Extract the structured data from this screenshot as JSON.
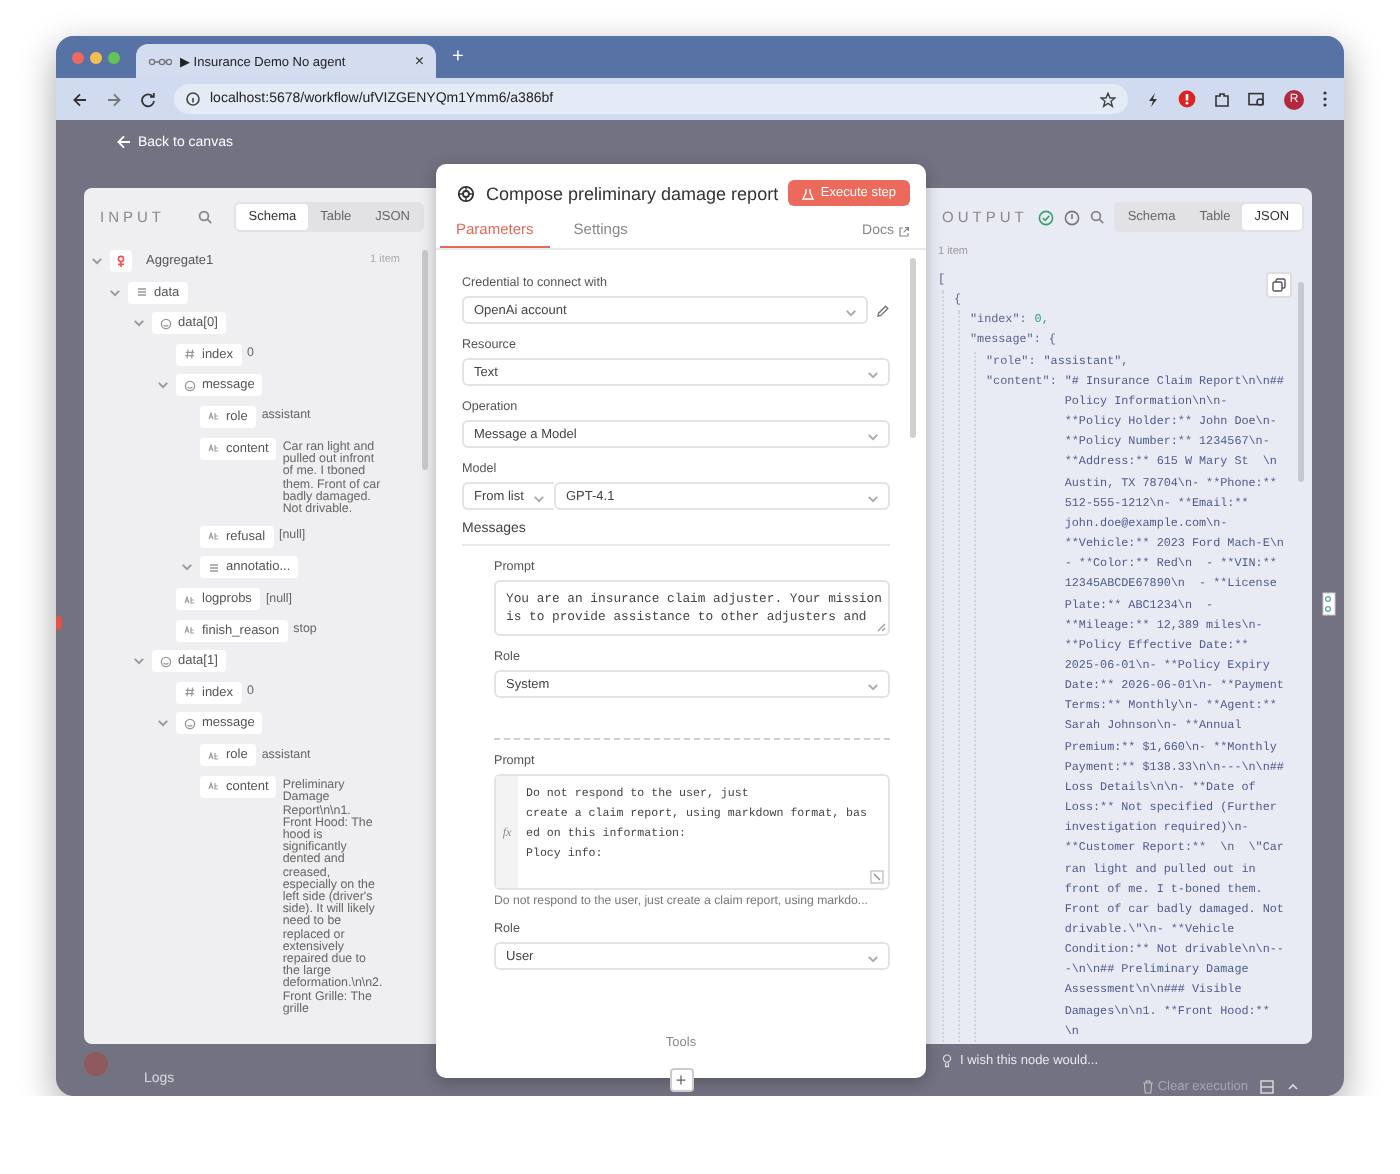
{
  "browser": {
    "tab": {
      "title": "▶ Insurance Demo No agent",
      "close": "×"
    },
    "new_tab": "+",
    "url": "localhost:5678/workflow/ufVIZGENYQm1Ymm6/a386bf",
    "profile": "R"
  },
  "back_link": "Back to canvas",
  "input_panel": {
    "title": "INPUT",
    "tabs": [
      {
        "label": "Schema",
        "selected": true
      },
      {
        "label": "Table",
        "selected": false
      },
      {
        "label": "JSON",
        "selected": false
      }
    ],
    "source": {
      "name": "Aggregate1",
      "count": "1 item",
      "expanded": true
    },
    "tree": [
      {
        "kind": "array",
        "name": "data",
        "expanded": true,
        "children": [
          {
            "kind": "object",
            "name": "data[0]",
            "expanded": true,
            "children": [
              {
                "kind": "number",
                "name": "index",
                "value": "0"
              },
              {
                "kind": "object",
                "name": "message",
                "expanded": true,
                "children": [
                  {
                    "kind": "string",
                    "name": "role",
                    "value": "assistant"
                  },
                  {
                    "kind": "string",
                    "name": "content",
                    "value": "Car ran light and pulled out infront of me. I tboned them. Front of car badly damaged. Not drivable."
                  },
                  {
                    "kind": "string",
                    "name": "refusal",
                    "value": "[null]"
                  },
                  {
                    "kind": "array",
                    "name": "annotatio...",
                    "expanded": true
                  }
                ]
              },
              {
                "kind": "string",
                "name": "logprobs",
                "value": "[null]"
              },
              {
                "kind": "string",
                "name": "finish_reason",
                "value": "stop"
              }
            ]
          },
          {
            "kind": "object",
            "name": "data[1]",
            "expanded": true,
            "children": [
              {
                "kind": "number",
                "name": "index",
                "value": "0"
              },
              {
                "kind": "object",
                "name": "message",
                "expanded": true,
                "children": [
                  {
                    "kind": "string",
                    "name": "role",
                    "value": "assistant"
                  },
                  {
                    "kind": "string",
                    "name": "content",
                    "value": "Preliminary Damage Report\\n\\n1. Front Hood: The hood is significantly dented and creased, especially on the left side (driver's side). It will likely need to be replaced or extensively repaired due to the large deformation.\\n\\n2. Front Grille: The grille"
                  }
                ]
              }
            ]
          }
        ]
      }
    ]
  },
  "modal": {
    "title": "Compose preliminary damage report",
    "execute_button": "Execute step",
    "tabs": [
      {
        "label": "Parameters",
        "selected": true
      },
      {
        "label": "Settings",
        "selected": false
      }
    ],
    "docs": "Docs",
    "credential": {
      "label": "Credential to connect with",
      "value": "OpenAi account"
    },
    "resource": {
      "label": "Resource",
      "value": "Text"
    },
    "operation": {
      "label": "Operation",
      "value": "Message a Model"
    },
    "model": {
      "label": "Model",
      "mode": "From list",
      "value": "GPT-4.1"
    },
    "messages_label": "Messages",
    "messages": [
      {
        "kind": "plain",
        "prompt_label": "Prompt",
        "lines": [
          "You are an insurance claim adjuster. Your mission",
          "is to provide assistance to other adjusters and"
        ],
        "role_label": "Role",
        "role": "System"
      },
      {
        "kind": "expression",
        "prompt_label": "Prompt",
        "gutter": "fx",
        "lines": [
          "Do not respond to the user, just",
          "create a claim report, using markdown format, bas",
          "ed on this information:",
          "Plocy info:"
        ],
        "preview": "Do not respond to the user, just  create a claim report, using markdo...",
        "role_label": "Role",
        "role": "User"
      }
    ],
    "tools_label": "Tools",
    "add_button": "+"
  },
  "output_panel": {
    "title": "OUTPUT",
    "tabs": [
      {
        "label": "Schema",
        "selected": false
      },
      {
        "label": "Table",
        "selected": false
      },
      {
        "label": "JSON",
        "selected": true
      }
    ],
    "count": "1 item",
    "json": [
      {
        "text": "[",
        "children": [
          {
            "text": "{",
            "children": [
              {
                "key": "\"index\":",
                "kind": "number",
                "value": "0,"
              },
              {
                "key": "\"message\":",
                "text": "{",
                "children": [
                  {
                    "key": "\"role\":",
                    "kind": "string",
                    "value": "\"assistant\","
                  },
                  {
                    "key": "\"content\":",
                    "kind": "string",
                    "value": "\"# Insurance Claim Report\\n\\n## Policy Information\\n\\n- **Policy Holder:** John Doe\\n- **Policy Number:** 1234567\\n- **Address:** 615 W Mary St  \\n  Austin, TX 78704\\n- **Phone:** 512-555-1212\\n- **Email:** john.doe@example.com\\n- **Vehicle:** 2023 Ford Mach-E\\n  - **Color:** Red\\n  - **VIN:** 12345ABCDE67890\\n  - **License Plate:** ABC1234\\n  - **Mileage:** 12,389 miles\\n- **Policy Effective Date:** 2025-06-01\\n- **Policy Expiry Date:** 2026-06-01\\n- **Payment Terms:** Monthly\\n- **Agent:** Sarah Johnson\\n- **Annual Premium:** $1,660\\n- **Monthly Payment:** $138.33\\n\\n---\\n\\n## Loss Details\\n\\n- **Date of Loss:** Not specified (Further investigation required)\\n- **Customer Report:**  \\n  \\\"Car ran light and pulled out in front of me. I t-boned them. Front of car badly damaged. Not drivable.\\\"\\n- **Vehicle Condition:** Not drivable\\n\\n---\\n\\n## Preliminary Damage Assessment\\n\\n### Visible Damages\\n\\n1. **Front Hood:**  \\n"
                  }
                ]
              }
            ]
          }
        ]
      }
    ],
    "feedback": "I wish this node would..."
  },
  "footer": {
    "logs": "Logs",
    "clear_execution": "Clear execution"
  }
}
